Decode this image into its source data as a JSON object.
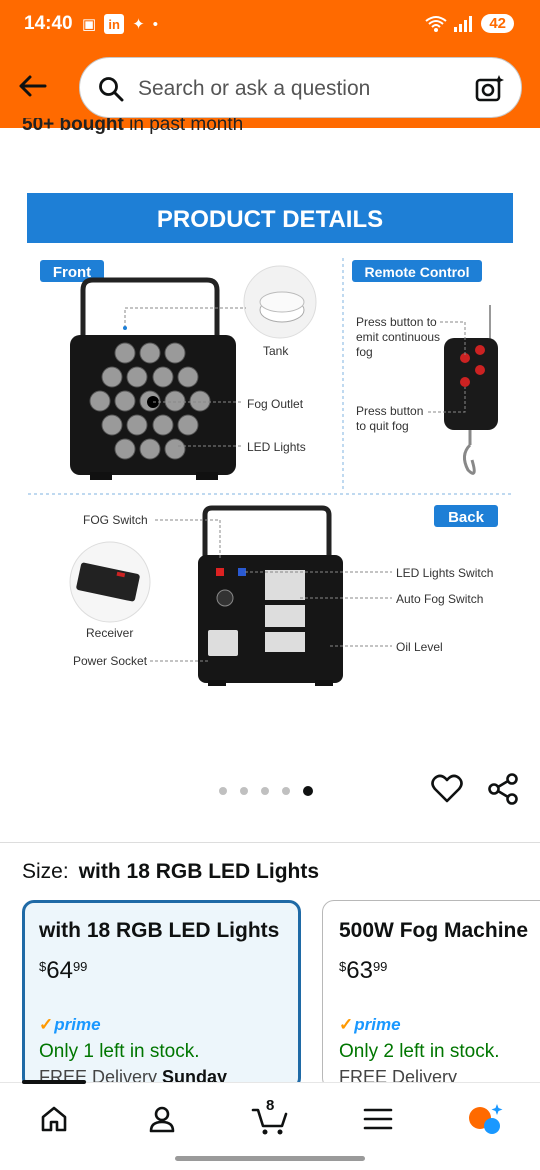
{
  "status_bar": {
    "time": "14:40",
    "battery": "42",
    "icons": [
      "screenshot-icon",
      "linkedin-icon",
      "flame-icon",
      "dot-icon",
      "wifi-icon",
      "signal-icon"
    ]
  },
  "header": {
    "search_placeholder": "Search or ask a question",
    "bought_prefix": "50+ bought",
    "bought_suffix": " in past month"
  },
  "product_image": {
    "banner": "PRODUCT DETAILS",
    "front_label": "Front",
    "remote_label": "Remote Control",
    "back_label": "Back",
    "front_callouts": [
      "Tank",
      "Fog Outlet",
      "LED Lights"
    ],
    "remote_press1": [
      "Press button to",
      "emit continuous",
      "fog"
    ],
    "remote_press2": [
      "Press button",
      "to quit fog"
    ],
    "back_callouts_left": [
      "FOG Switch",
      "Receiver",
      "Power Socket"
    ],
    "back_callouts_right": [
      "LED Lights Switch",
      "Auto Fog Switch",
      "Oil Level"
    ],
    "colors": {
      "banner": "#1e7fd6",
      "tag": "#1e7fd6"
    }
  },
  "pager": {
    "count": 5,
    "active": 4
  },
  "size": {
    "label": "Size:",
    "selected": "with 18 RGB LED Lights"
  },
  "options": [
    {
      "title": "with 18 RGB LED Lights",
      "currency": "$",
      "dollars": "64",
      "cents": "99",
      "prime": "prime",
      "stock": "Only 1 left in stock.",
      "delivery_prefix": "FREE Delivery ",
      "delivery_day": "Sunday"
    },
    {
      "title": "500W Fog Machine",
      "currency": "$",
      "dollars": "63",
      "cents": "99",
      "prime": "prime",
      "stock": "Only 2 left in stock.",
      "delivery_prefix": "FREE Delivery",
      "delivery_day": ""
    }
  ],
  "nav": {
    "cart_count": "8"
  },
  "theme": {
    "header_bg": "#ff6a00",
    "selected_border": "#1f6aa6",
    "stock_green": "#007600",
    "prime_blue": "#1a98ff"
  }
}
